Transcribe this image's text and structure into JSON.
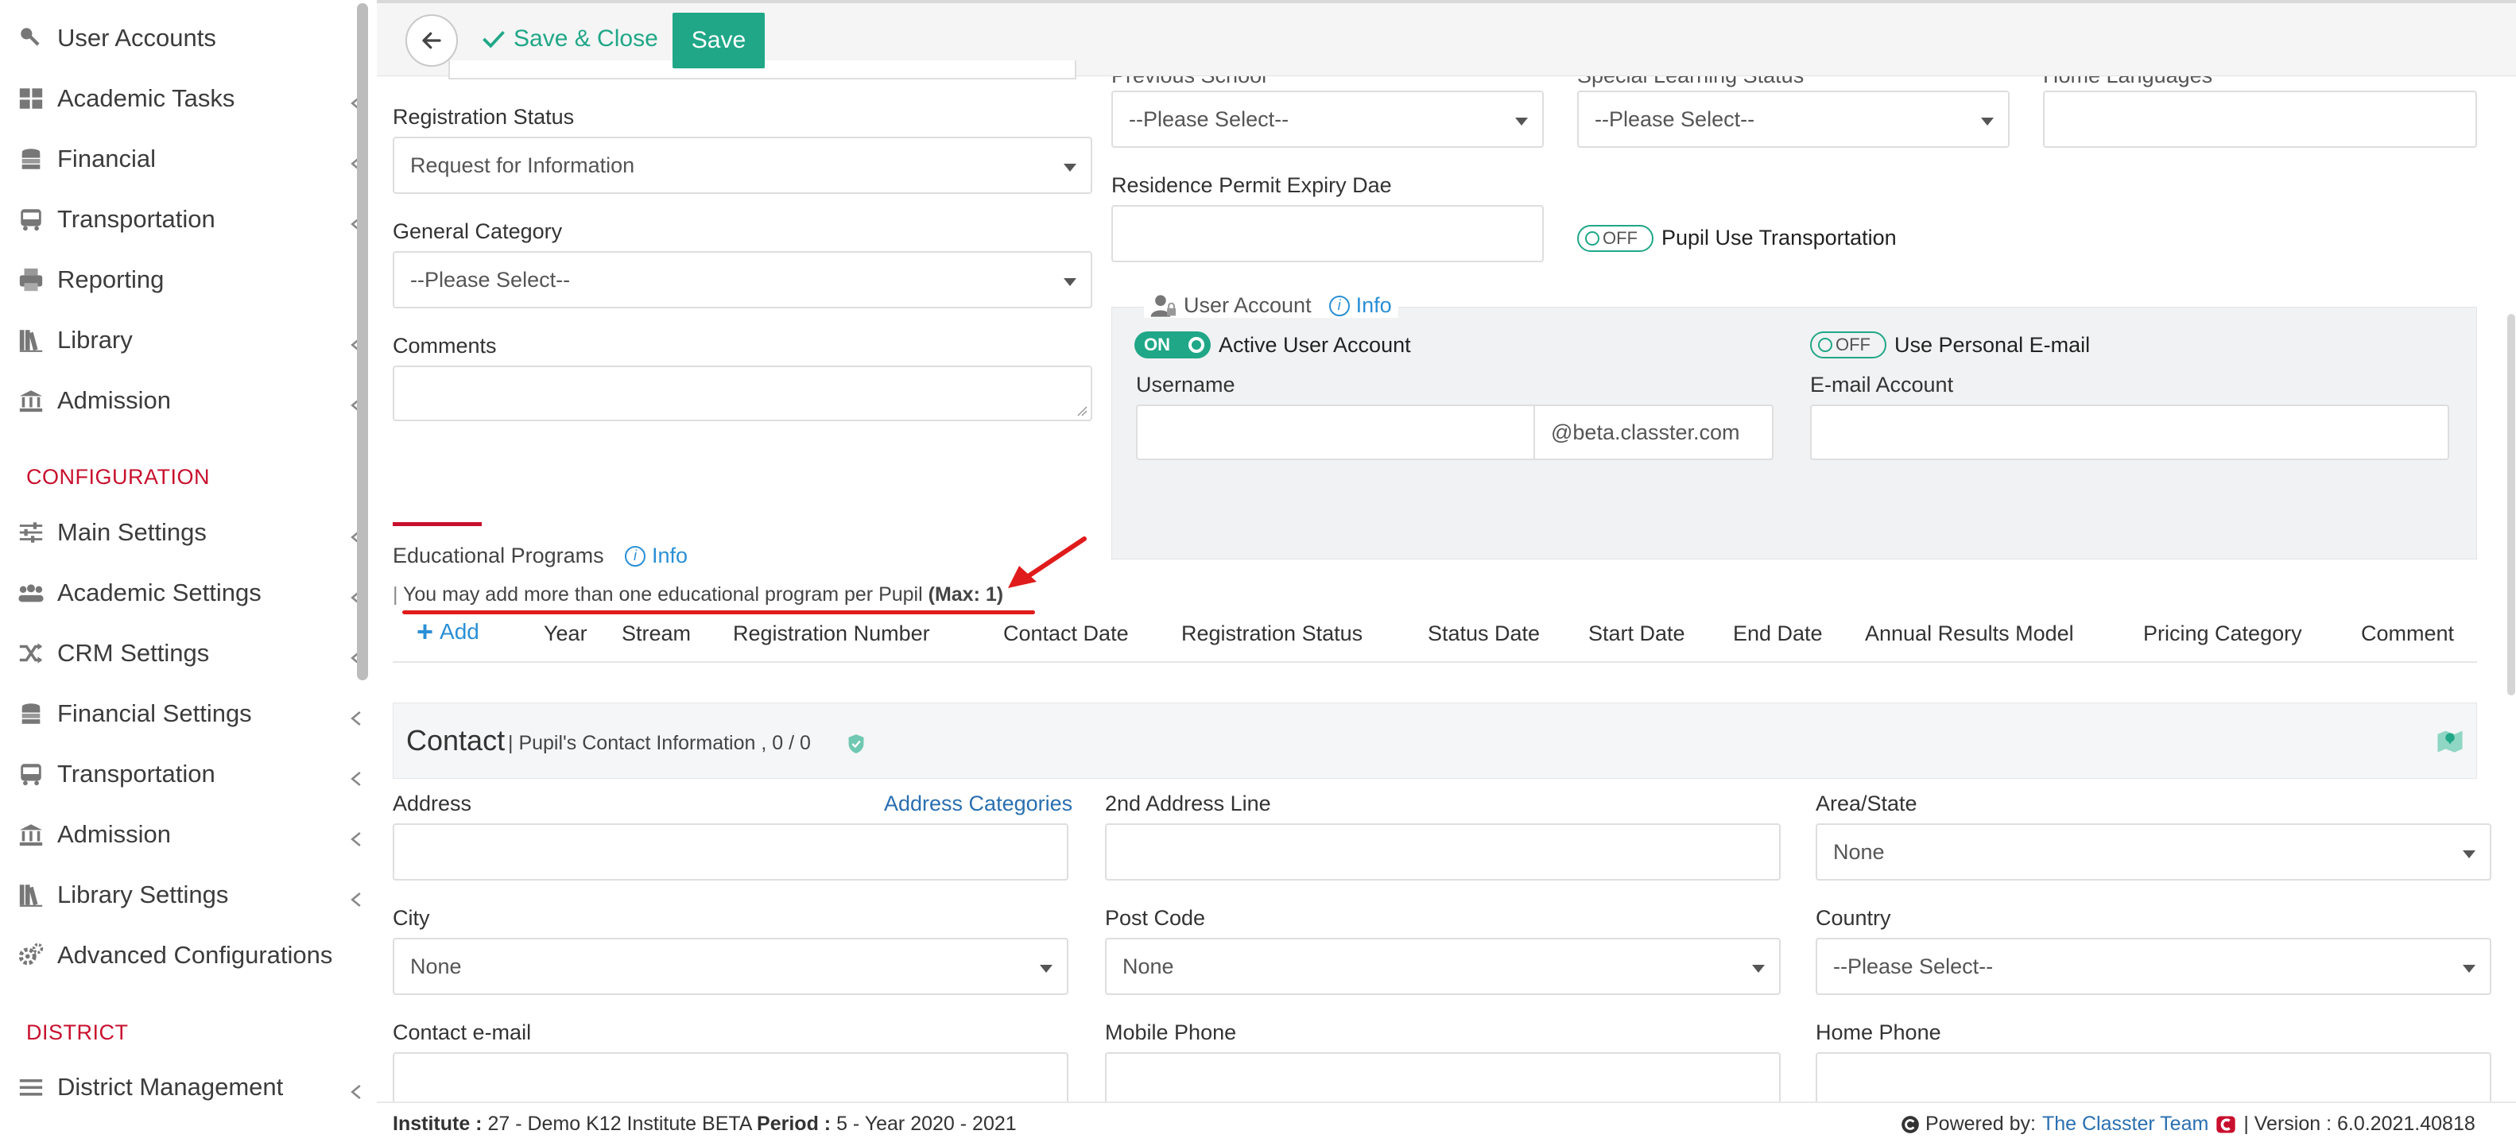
{
  "sidebar": {
    "items_top": [
      {
        "label": "User Accounts",
        "icon": "key-icon"
      },
      {
        "label": "Academic Tasks",
        "icon": "dashboard-icon"
      },
      {
        "label": "Financial",
        "icon": "coins-icon"
      },
      {
        "label": "Transportation",
        "icon": "bus-icon"
      },
      {
        "label": "Reporting",
        "icon": "printer-icon"
      },
      {
        "label": "Library",
        "icon": "books-icon"
      },
      {
        "label": "Admission",
        "icon": "institution-icon"
      }
    ],
    "config_header": "CONFIGURATION",
    "items_config": [
      {
        "label": "Main Settings",
        "icon": "sliders-icon"
      },
      {
        "label": "Academic Settings",
        "icon": "users-icon"
      },
      {
        "label": "CRM Settings",
        "icon": "shuffle-icon"
      },
      {
        "label": "Financial Settings",
        "icon": "coins-icon"
      },
      {
        "label": "Transportation",
        "icon": "bus-icon"
      },
      {
        "label": "Admission",
        "icon": "institution-icon"
      },
      {
        "label": "Library Settings",
        "icon": "books-icon"
      },
      {
        "label": "Advanced Configurations",
        "icon": "cogs-icon"
      }
    ],
    "district_header": "DISTRICT",
    "items_district": [
      {
        "label": "District Management",
        "icon": "menu-icon"
      }
    ]
  },
  "toolbar": {
    "save_close_label": "Save & Close",
    "save_label": "Save"
  },
  "form": {
    "previous_school_label": "Previous School",
    "special_learning_label": "Special Learning Status",
    "home_languages_label": "Home Languages",
    "registration_status_label": "Registration Status",
    "registration_status_value": "Request for Information",
    "previous_school_value": "--Please Select--",
    "special_learning_value": "--Please Select--",
    "residence_permit_label": "Residence Permit Expiry Dae",
    "general_category_label": "General Category",
    "general_category_value": "--Please Select--",
    "transport_toggle": "OFF",
    "transport_label": "Pupil Use Transportation",
    "comments_label": "Comments"
  },
  "user_account": {
    "title": "User Account",
    "info": "Info",
    "active_toggle": "ON",
    "active_label": "Active User Account",
    "personal_toggle": "OFF",
    "personal_label": "Use Personal E-mail",
    "username_label": "Username",
    "domain_suffix": "@beta.classter.com",
    "email_label": "E-mail Account"
  },
  "edu_programs": {
    "title": "Educational Programs",
    "info": "Info",
    "note": "You may add more than one educational program per Pupil",
    "max": "(Max: 1)",
    "add_label": "Add",
    "columns": [
      "Year",
      "Stream",
      "Registration Number",
      "Contact Date",
      "Registration Status",
      "Status Date",
      "Start Date",
      "End Date",
      "Annual Results Model",
      "Pricing Category",
      "Comment"
    ]
  },
  "contact": {
    "title": "Contact",
    "subtitle": "| Pupil's Contact Information , 0 / 0",
    "address_label": "Address",
    "address_categories": "Address Categories",
    "address2_label": "2nd Address Line",
    "area_label": "Area/State",
    "area_value": "None",
    "city_label": "City",
    "city_value": "None",
    "postcode_label": "Post Code",
    "postcode_value": "None",
    "country_label": "Country",
    "country_value": "--Please Select--",
    "email_label": "Contact e-mail",
    "mobile_label": "Mobile Phone",
    "home_label": "Home Phone"
  },
  "footer": {
    "institute_key": "Institute :",
    "institute_val": "27 - Demo K12 Institute BETA",
    "period_key": "Period :",
    "period_val": "5 - Year 2020 - 2021",
    "powered": "Powered by:",
    "team": "The Classter Team",
    "version": "| Version : 6.0.2021.40818"
  },
  "colors": {
    "accent": "#20a787",
    "brand_red": "#c8102e",
    "link": "#2a8fd6"
  }
}
